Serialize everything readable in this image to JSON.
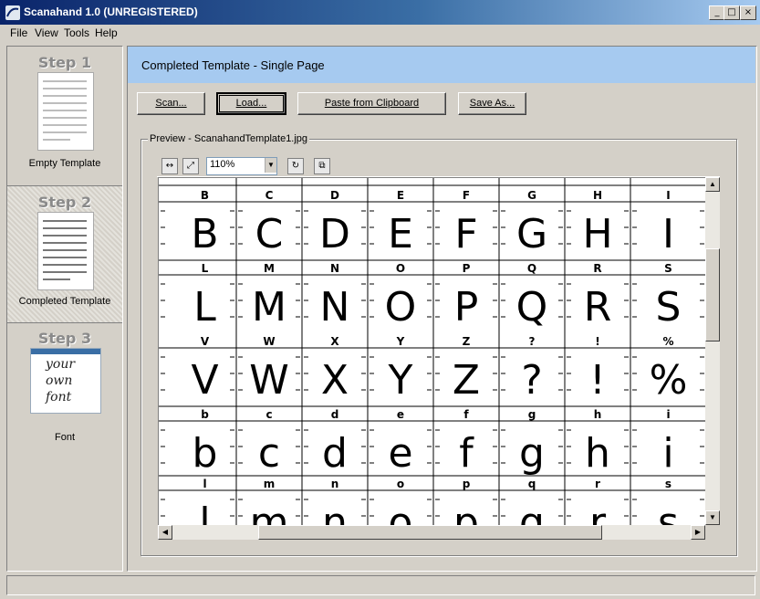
{
  "window": {
    "title": "Scanahand 1.0 (UNREGISTERED)",
    "controls": [
      "_",
      "□",
      "×"
    ]
  },
  "menu": [
    {
      "label": "File"
    },
    {
      "label": "View"
    },
    {
      "label": "Tools"
    },
    {
      "label": "Help"
    }
  ],
  "steps": [
    {
      "title": "Step 1",
      "label": "Empty Template"
    },
    {
      "title": "Step 2",
      "label": "Completed Template"
    },
    {
      "title": "Step 3",
      "label": "Font"
    }
  ],
  "font_thumb_words": [
    "your",
    "own",
    "font"
  ],
  "header": {
    "title": "Completed Template - Single Page"
  },
  "buttons": {
    "scan": "Scan...",
    "load": "Load...",
    "paste": "Paste from Clipboard",
    "save": "Save As..."
  },
  "preview": {
    "label": "Preview - ScanahandTemplate1.jpg",
    "zoom": "110%"
  },
  "template_rows": [
    {
      "labels": [
        "B",
        "C",
        "D",
        "E",
        "F",
        "G",
        "H",
        "I"
      ],
      "glyphs": [
        "B",
        "C",
        "D",
        "E",
        "F",
        "G",
        "H",
        "I"
      ]
    },
    {
      "labels": [
        "L",
        "M",
        "N",
        "O",
        "P",
        "Q",
        "R",
        "S"
      ],
      "glyphs": [
        "L",
        "M",
        "N",
        "O",
        "P",
        "Q",
        "R",
        "S"
      ]
    },
    {
      "labels": [
        "V",
        "W",
        "X",
        "Y",
        "Z",
        "?",
        "!",
        "%"
      ],
      "glyphs": [
        "V",
        "W",
        "X",
        "Y",
        "Z",
        "?",
        "!",
        "%"
      ]
    },
    {
      "labels": [
        "b",
        "c",
        "d",
        "e",
        "f",
        "g",
        "h",
        "i"
      ],
      "glyphs": [
        "b",
        "c",
        "d",
        "e",
        "f",
        "g",
        "h",
        "i"
      ]
    },
    {
      "labels": [
        "l",
        "m",
        "n",
        "o",
        "p",
        "q",
        "r",
        "s"
      ],
      "glyphs": [
        "l",
        "m",
        "n",
        "o",
        "p",
        "q",
        "r",
        "s"
      ]
    }
  ]
}
